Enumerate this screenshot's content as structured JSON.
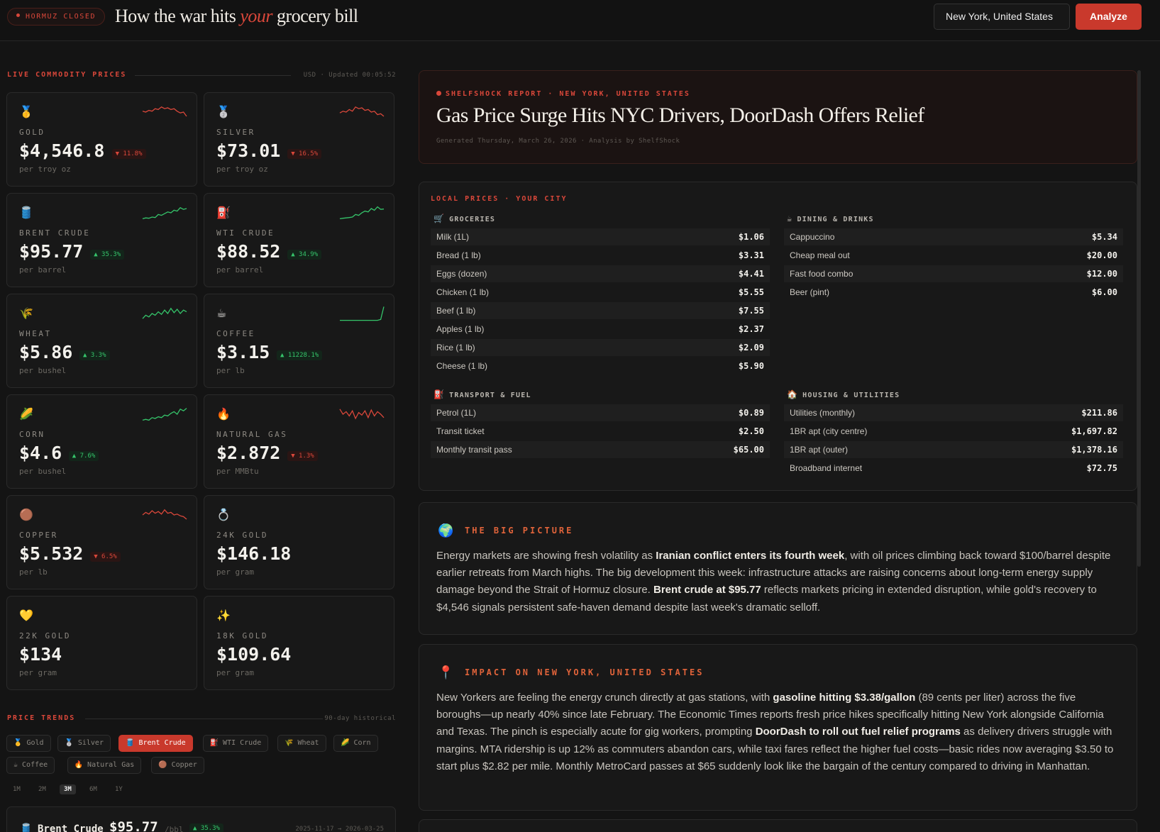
{
  "header": {
    "badge": "HORMUZ CLOSED",
    "title_pre": "How the war hits ",
    "title_accent": "your",
    "title_post": " grocery bill",
    "location_value": "New York, United States",
    "analyze_label": "Analyze"
  },
  "commodities_section": {
    "label": "LIVE COMMODITY PRICES",
    "meta": "USD · Updated 00:05:52"
  },
  "commodities": [
    {
      "emoji": "🥇",
      "icon": "gold-medal-icon",
      "name": "GOLD",
      "price": "$4,546.8",
      "change": "▼ 11.8%",
      "dir": "down",
      "unit": "per troy oz",
      "spark": [
        0.45,
        0.5,
        0.4,
        0.45,
        0.3,
        0.35,
        0.2,
        0.3,
        0.25,
        0.35,
        0.3,
        0.45,
        0.55,
        0.5,
        0.75
      ]
    },
    {
      "emoji": "🥈",
      "icon": "silver-medal-icon",
      "name": "SILVER",
      "price": "$73.01",
      "change": "▼ 16.5%",
      "dir": "down",
      "unit": "per troy oz",
      "spark": [
        0.55,
        0.45,
        0.5,
        0.35,
        0.45,
        0.2,
        0.3,
        0.25,
        0.4,
        0.35,
        0.5,
        0.45,
        0.65,
        0.6,
        0.75
      ]
    },
    {
      "emoji": "🛢️",
      "icon": "oil-barrel-icon",
      "name": "BRENT CRUDE",
      "price": "$95.77",
      "change": "▲ 35.3%",
      "dir": "up",
      "unit": "per barrel",
      "spark": [
        0.85,
        0.8,
        0.82,
        0.75,
        0.78,
        0.6,
        0.65,
        0.55,
        0.45,
        0.5,
        0.35,
        0.4,
        0.2,
        0.3,
        0.25
      ]
    },
    {
      "emoji": "⛽",
      "icon": "fuel-pump-icon",
      "name": "WTI CRUDE",
      "price": "$88.52",
      "change": "▲ 34.9%",
      "dir": "up",
      "unit": "per barrel",
      "spark": [
        0.85,
        0.82,
        0.8,
        0.78,
        0.75,
        0.6,
        0.65,
        0.5,
        0.4,
        0.45,
        0.25,
        0.35,
        0.15,
        0.3,
        0.28
      ]
    },
    {
      "emoji": "🌾",
      "icon": "wheat-icon",
      "name": "WHEAT",
      "price": "$5.86",
      "change": "▲ 3.3%",
      "dir": "up",
      "unit": "per bushel",
      "spark": [
        0.8,
        0.6,
        0.7,
        0.5,
        0.6,
        0.4,
        0.55,
        0.3,
        0.5,
        0.2,
        0.45,
        0.25,
        0.5,
        0.3,
        0.4
      ]
    },
    {
      "emoji": "☕",
      "icon": "coffee-icon",
      "name": "COFFEE",
      "price": "$3.15",
      "change": "▲ 11228.1%",
      "dir": "up",
      "unit": "per lb",
      "spark": [
        0.9,
        0.9,
        0.9,
        0.9,
        0.9,
        0.9,
        0.9,
        0.9,
        0.9,
        0.9,
        0.9,
        0.9,
        0.9,
        0.85,
        0.1
      ]
    },
    {
      "emoji": "🌽",
      "icon": "corn-icon",
      "name": "CORN",
      "price": "$4.6",
      "change": "▲ 7.6%",
      "dir": "up",
      "unit": "per bushel",
      "spark": [
        0.85,
        0.8,
        0.85,
        0.7,
        0.75,
        0.65,
        0.7,
        0.55,
        0.6,
        0.45,
        0.35,
        0.5,
        0.2,
        0.3,
        0.15
      ]
    },
    {
      "emoji": "🔥",
      "icon": "flame-icon",
      "name": "NATURAL GAS",
      "price": "$2.872",
      "change": "▼ 1.3%",
      "dir": "down",
      "unit": "per MMBtu",
      "spark": [
        0.2,
        0.5,
        0.35,
        0.6,
        0.3,
        0.75,
        0.4,
        0.55,
        0.3,
        0.7,
        0.25,
        0.6,
        0.35,
        0.5,
        0.7
      ]
    },
    {
      "emoji": "🟤",
      "icon": "copper-icon",
      "name": "COPPER",
      "price": "$5.532",
      "change": "▼ 6.5%",
      "dir": "down",
      "unit": "per lb",
      "spark": [
        0.5,
        0.35,
        0.45,
        0.25,
        0.4,
        0.3,
        0.45,
        0.2,
        0.4,
        0.35,
        0.5,
        0.45,
        0.55,
        0.6,
        0.75
      ]
    },
    {
      "emoji": "💍",
      "icon": "ring-icon",
      "name": "24K GOLD",
      "price": "$146.18",
      "change": "",
      "dir": "",
      "unit": "per gram",
      "spark": []
    },
    {
      "emoji": "💛",
      "icon": "yellow-heart-icon",
      "name": "22K GOLD",
      "price": "$134",
      "change": "",
      "dir": "",
      "unit": "per gram",
      "spark": []
    },
    {
      "emoji": "✨",
      "icon": "sparkles-icon",
      "name": "18K GOLD",
      "price": "$109.64",
      "change": "",
      "dir": "",
      "unit": "per gram",
      "spark": []
    }
  ],
  "trends": {
    "label": "PRICE TRENDS",
    "meta": "90-day historical",
    "chips": [
      {
        "emoji": "🥇",
        "label": "Gold",
        "active": false
      },
      {
        "emoji": "🥈",
        "label": "Silver",
        "active": false
      },
      {
        "emoji": "🛢️",
        "label": "Brent Crude",
        "active": true
      },
      {
        "emoji": "⛽",
        "label": "WTI Crude",
        "active": false
      },
      {
        "emoji": "🌾",
        "label": "Wheat",
        "active": false
      },
      {
        "emoji": "🌽",
        "label": "Corn",
        "active": false
      },
      {
        "emoji": "☕",
        "label": "Coffee",
        "active": false
      },
      {
        "emoji": "🔥",
        "label": "Natural Gas",
        "active": false
      },
      {
        "emoji": "🟤",
        "label": "Copper",
        "active": false
      }
    ],
    "ranges": [
      "1M",
      "2M",
      "3M",
      "6M",
      "1Y"
    ],
    "active_range": "3M",
    "selected": {
      "emoji": "🛢️",
      "name": "Brent Crude",
      "price": "$95.77",
      "unit": "/bbl",
      "change": "▲ 35.3%",
      "dates": "2025-11-17 → 2026-03-25"
    }
  },
  "report": {
    "kicker": "SHELFSHOCK REPORT · NEW YORK, UNITED STATES",
    "headline": "Gas Price Surge Hits NYC Drivers, DoorDash Offers Relief",
    "generated": "Generated Thursday, March 26, 2026 · Analysis by ShelfShock"
  },
  "local_prices": {
    "label": "LOCAL PRICES · YOUR CITY",
    "groceries": {
      "title": "GROCERIES",
      "emoji": "🛒",
      "items": [
        {
          "label": "Milk (1L)",
          "value": "$1.06"
        },
        {
          "label": "Bread (1 lb)",
          "value": "$3.31"
        },
        {
          "label": "Eggs (dozen)",
          "value": "$4.41"
        },
        {
          "label": "Chicken (1 lb)",
          "value": "$5.55"
        },
        {
          "label": "Beef (1 lb)",
          "value": "$7.55"
        },
        {
          "label": "Apples (1 lb)",
          "value": "$2.37"
        },
        {
          "label": "Rice (1 lb)",
          "value": "$2.09"
        },
        {
          "label": "Cheese (1 lb)",
          "value": "$5.90"
        }
      ]
    },
    "dining": {
      "title": "DINING & DRINKS",
      "emoji": "☕",
      "items": [
        {
          "label": "Cappuccino",
          "value": "$5.34"
        },
        {
          "label": "Cheap meal out",
          "value": "$20.00"
        },
        {
          "label": "Fast food combo",
          "value": "$12.00"
        },
        {
          "label": "Beer (pint)",
          "value": "$6.00"
        }
      ]
    },
    "transport": {
      "title": "TRANSPORT & FUEL",
      "emoji": "⛽",
      "items": [
        {
          "label": "Petrol (1L)",
          "value": "$0.89"
        },
        {
          "label": "Transit ticket",
          "value": "$2.50"
        },
        {
          "label": "Monthly transit pass",
          "value": "$65.00"
        }
      ]
    },
    "housing": {
      "title": "HOUSING & UTILITIES",
      "emoji": "🏠",
      "items": [
        {
          "label": "Utilities (monthly)",
          "value": "$211.86"
        },
        {
          "label": "1BR apt (city centre)",
          "value": "$1,697.82"
        },
        {
          "label": "1BR apt (outer)",
          "value": "$1,378.16"
        },
        {
          "label": "Broadband internet",
          "value": "$72.75"
        }
      ]
    }
  },
  "big_picture": {
    "emoji": "🌍",
    "title": "THE BIG PICTURE",
    "parts": [
      {
        "t": "Energy markets are showing fresh volatility as ",
        "b": false
      },
      {
        "t": "Iranian conflict enters its fourth week",
        "b": true
      },
      {
        "t": ", with oil prices climbing back toward $100/barrel despite earlier retreats from March highs. The big development this week: infrastructure attacks are raising concerns about long-term energy supply damage beyond the Strait of Hormuz closure. ",
        "b": false
      },
      {
        "t": "Brent crude at $95.77",
        "b": true
      },
      {
        "t": " reflects markets pricing in extended disruption, while gold's recovery to $4,546 signals persistent safe-haven demand despite last week's dramatic selloff.",
        "b": false
      }
    ]
  },
  "impact": {
    "emoji": "📍",
    "title": "IMPACT ON NEW YORK, UNITED STATES",
    "parts": [
      {
        "t": "New Yorkers are feeling the energy crunch directly at gas stations, with ",
        "b": false
      },
      {
        "t": "gasoline hitting $3.38/gallon",
        "b": true
      },
      {
        "t": " (89 cents per liter) across the five boroughs—up nearly 40% since late February. The Economic Times reports fresh price hikes specifically hitting New York alongside California and Texas. The pinch is especially acute for gig workers, prompting ",
        "b": false
      },
      {
        "t": "DoorDash to roll out fuel relief programs",
        "b": true
      },
      {
        "t": " as delivery drivers struggle with margins. MTA ridership is up 12% as commuters abandon cars, while taxi fares reflect the higher fuel costs—basic rides now averaging $3.50 to start plus $2.82 per mile. Monthly MetroCard passes at $65 suddenly look like the bargain of the century compared to driving in Manhattan.",
        "b": false
      }
    ]
  },
  "colors": {
    "accent": "#d9473a",
    "up": "#35c46a",
    "down": "#d9473a"
  }
}
